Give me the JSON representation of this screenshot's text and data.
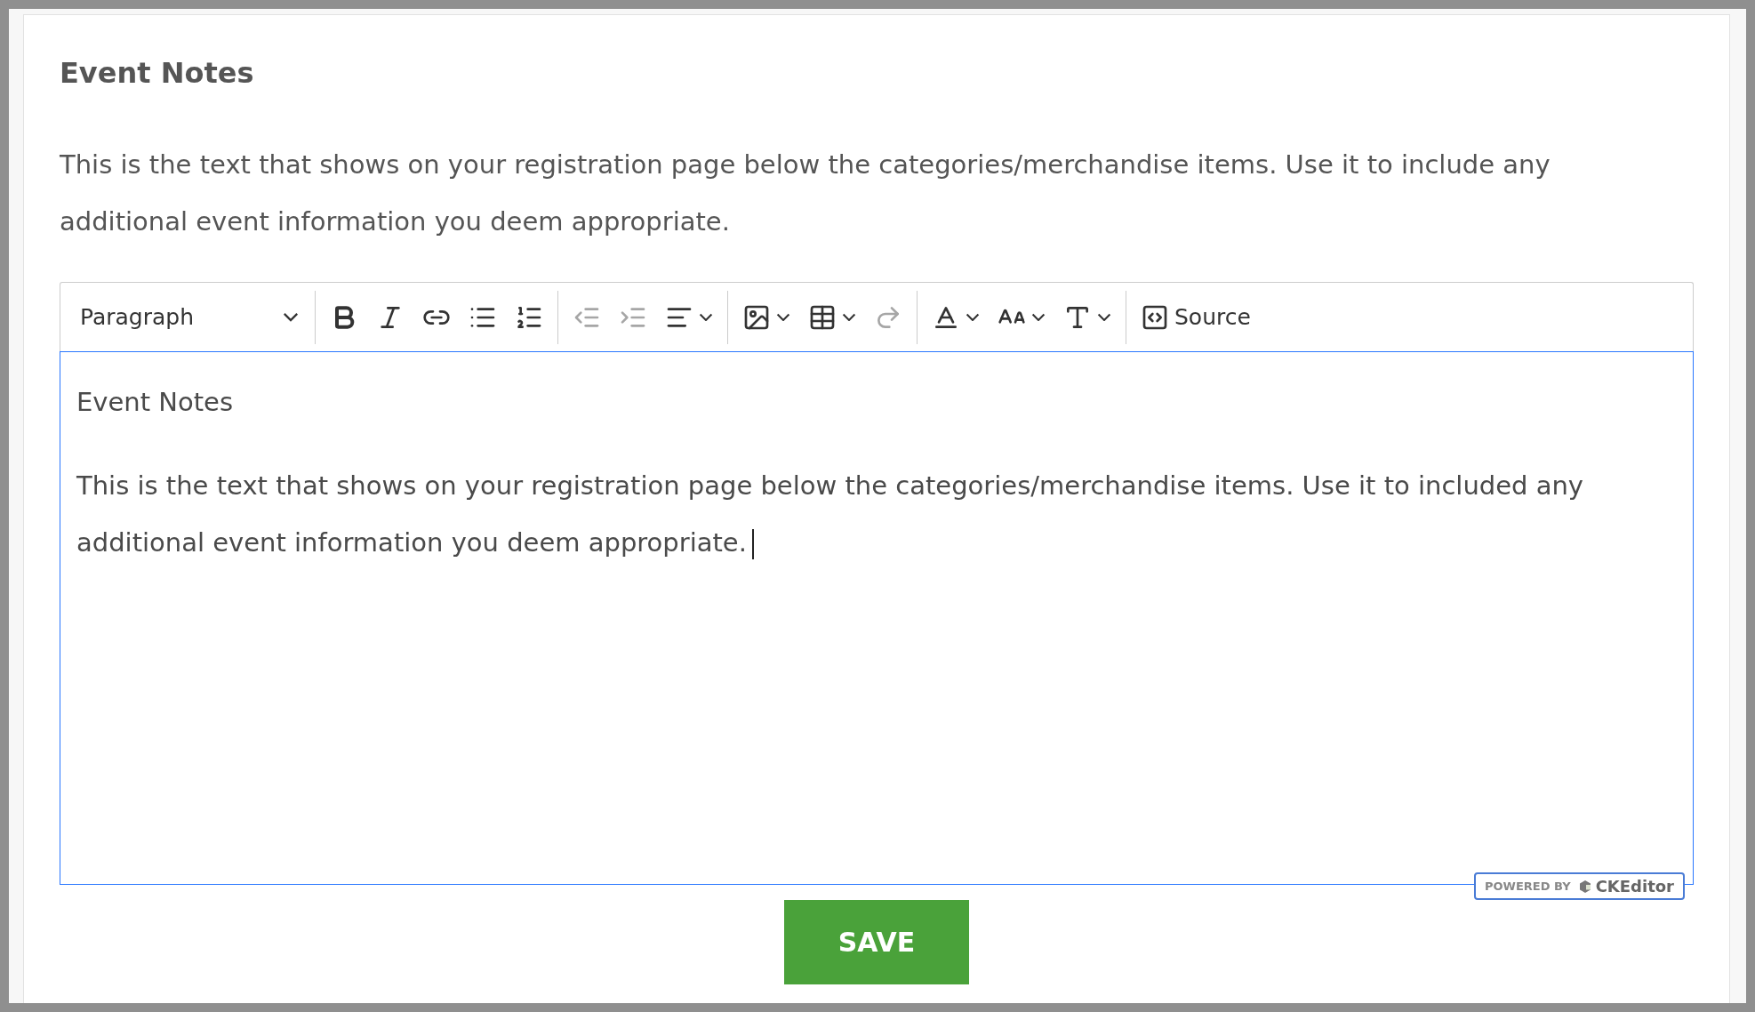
{
  "section": {
    "title": "Event Notes",
    "description": "This is the text that shows on your registration page below the categories/merchandise items. Use it to include any additional event information you deem appropriate."
  },
  "editor": {
    "toolbar": {
      "heading_dropdown": {
        "label": "Paragraph"
      },
      "groups": [
        {
          "items": [
            {
              "kind": "button",
              "disabled": false
            },
            {
              "kind": "button",
              "disabled": false
            },
            {
              "kind": "button",
              "disabled": false
            },
            {
              "kind": "button",
              "disabled": false
            },
            {
              "kind": "button",
              "disabled": false
            }
          ]
        },
        {
          "items": [
            {
              "kind": "button",
              "disabled": true
            },
            {
              "kind": "button",
              "disabled": true
            },
            {
              "kind": "split",
              "disabled": false
            }
          ]
        },
        {
          "items": [
            {
              "kind": "split",
              "disabled": false
            },
            {
              "kind": "split",
              "disabled": false
            },
            {
              "kind": "button",
              "disabled": true
            }
          ]
        },
        {
          "items": [
            {
              "kind": "split",
              "disabled": false
            },
            {
              "kind": "split",
              "disabled": false
            },
            {
              "kind": "split",
              "disabled": false
            }
          ]
        },
        {
          "items": [
            {
              "kind": "labeled",
              "label": "Source",
              "disabled": false
            }
          ]
        }
      ]
    },
    "paragraphs": [
      "Event Notes",
      "This is the text that shows on your registration page below the categories/merchandise items. Use it to included any additional event information you deem appropriate."
    ],
    "focused": true,
    "badge": {
      "prefix": "POWERED BY",
      "brand": "CKEditor"
    }
  },
  "save_button": {
    "label": "SAVE"
  }
}
